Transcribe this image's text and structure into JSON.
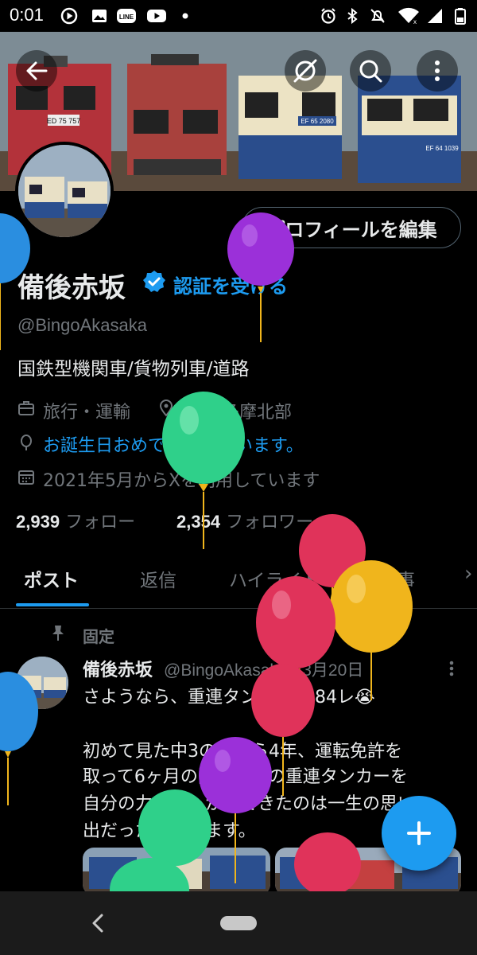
{
  "status_bar": {
    "time": "0:01",
    "left_icons": [
      "circle-play-icon",
      "image-icon",
      "line-app-icon",
      "youtube-icon",
      "dot-icon"
    ],
    "right_icons": [
      "alarm-icon",
      "bluetooth-icon",
      "mute-icon",
      "wifi-icon",
      "signal-icon",
      "battery-icon"
    ]
  },
  "header": {
    "banner_plates": [
      "ED 75 757",
      "EF 65 2080",
      "EF 64 1039"
    ]
  },
  "profile": {
    "edit_button": "プロフィールを編集",
    "name": "備後赤坂",
    "verify_link": "認証を受ける",
    "handle": "@BingoAkasaka",
    "bio": "国鉄型機関車/貨物列車/道路",
    "category": "旅行・運輸",
    "location": "東京 多摩北部",
    "birthday_text": "お誕生日おめでとうございます。",
    "joined": "2021年5月からXを利用しています",
    "following_count": "2,939",
    "following_label": "フォロー",
    "followers_count": "2,354",
    "followers_label": "フォロワー"
  },
  "tabs": [
    {
      "label": "ポスト",
      "active": true
    },
    {
      "label": "返信",
      "active": false
    },
    {
      "label": "ハイライト",
      "active": false
    },
    {
      "label": "記事",
      "active": false
    }
  ],
  "tab_more": "›",
  "tweet": {
    "pinned_label": "固定",
    "name": "備後赤坂",
    "handle": "@BingoAkasaka",
    "date": "· 3月20日",
    "line1": "さようなら、重連タンカー8084レ😭",
    "line2": "初めて見た中3の日から4年、運転免許を",
    "line3": "取って6ヶ月の間、憧れの重連タンカーを",
    "line4": "自分の力で追っかけできたのは一生の思い",
    "line5": "出だったと思います。"
  },
  "colors": {
    "accent": "#1d9bf0",
    "balloon_purple": "#9b30d9",
    "balloon_green": "#2fd08a",
    "balloon_red": "#e0335a",
    "balloon_yellow": "#f0b51c",
    "balloon_blue": "#2a8ee0"
  }
}
